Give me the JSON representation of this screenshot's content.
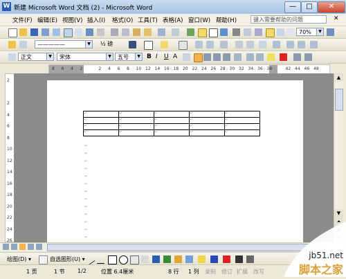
{
  "window": {
    "title": "新建 Microsoft Word 文档 (2) - Microsoft Word",
    "app_icon_letter": "W",
    "buttons": {
      "min": "—",
      "max": "□",
      "close": "✕"
    }
  },
  "menu": {
    "items": [
      "文件(F)",
      "编辑(E)",
      "视图(V)",
      "插入(I)",
      "格式(O)",
      "工具(T)",
      "表格(A)",
      "窗口(W)",
      "帮助(H)"
    ],
    "help_placeholder": "键入需要帮助的问题"
  },
  "standard_toolbar": {
    "zoom": "70%"
  },
  "drawing_line_toolbar": {
    "line_size": "½ 磅",
    "line_style": "—————"
  },
  "format_toolbar": {
    "style": "正文",
    "font": "宋体",
    "size": "五号",
    "bold": "B",
    "italic": "I",
    "underline": "U",
    "char_a": "A"
  },
  "ruler": {
    "h_ticks": [
      "8",
      "6",
      "4",
      "2",
      "",
      "2",
      "4",
      "6",
      "8",
      "10",
      "12",
      "14",
      "16",
      "18",
      "20",
      "22",
      "24",
      "26",
      "28",
      "30",
      "32",
      "34",
      "36",
      "38",
      "",
      "42",
      "44",
      "46",
      "48"
    ],
    "v_ticks": [
      "2",
      "",
      "2",
      "4",
      "6",
      "8",
      "10",
      "12",
      "14",
      "16",
      "18",
      "20",
      "22",
      "24",
      "26"
    ]
  },
  "document": {
    "cell_marker": "↵",
    "rows": 4,
    "cols": 5
  },
  "draw_toolbar": {
    "draw_label": "绘图(D) ▾",
    "autoshape_label": "自选图形(U) ▾"
  },
  "status": {
    "page": "1 页",
    "section": "1 节",
    "pages": "1/2",
    "position": "位置 6.4厘米",
    "line": "8 行",
    "column": "1 列",
    "rec": "录制",
    "trk": "修订",
    "ext": "扩展",
    "ovr": "改写"
  },
  "watermark": {
    "site": "jb51.net",
    "name": "脚本之家"
  },
  "colors": {
    "title_bg": "#b7cee8",
    "doc_bg": "#8c8c8c",
    "accent": "#2a5db0",
    "watermark": "#d9a03a"
  }
}
